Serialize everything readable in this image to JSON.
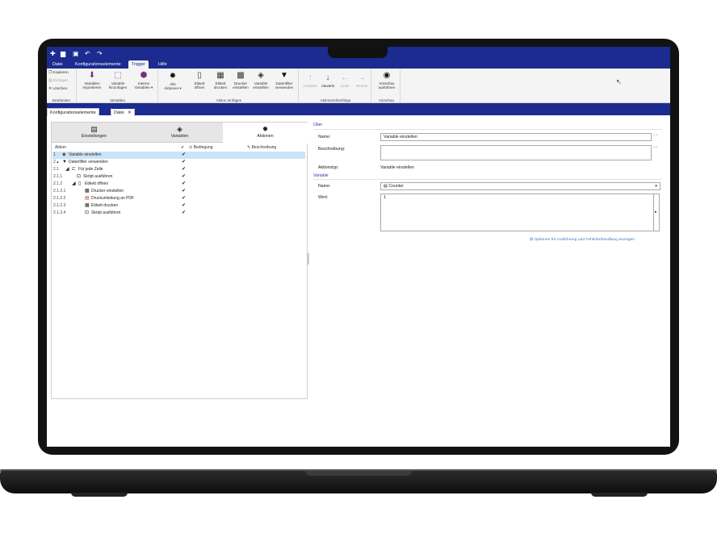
{
  "ribbon_tabs": [
    "Datei",
    "Konfigurationselemente",
    "Trigger",
    "Hilfe"
  ],
  "ribbon_active": "Trigger",
  "clipboard": {
    "copy": "Kopieren",
    "paste": "Einfügen",
    "delete": "Löschen",
    "label": "Bearbeiten"
  },
  "variables_group": {
    "label": "Variablen",
    "buttons": [
      "Variablen\nimportieren",
      "Variable\nhinzufügen",
      "Interne\nVariablen ▾"
    ]
  },
  "insert_group": {
    "label": "Aktion einfügen",
    "all_actions": "Alle\nAktionen ▾",
    "buttons": [
      "Etikett\nöffnen",
      "Etikett\ndrucken",
      "Drucker\neinstellen",
      "Variable\neinstellen",
      "Datenfilter\nverwenden"
    ]
  },
  "order_group": {
    "label": "Aktionsreihenfolge",
    "buttons": [
      "Aufwärts",
      "Abwärts",
      "Links",
      "Rechts"
    ]
  },
  "preview_group": {
    "label": "Vorschau",
    "button": "Vorschau\nausführen"
  },
  "doc_tabs": [
    "Konfigurationselemente",
    "Datei"
  ],
  "panel_tabs": [
    "Einstellungen",
    "Variablen",
    "Aktionen"
  ],
  "table_headers": {
    "action": "Aktion",
    "condition": "Bedingung",
    "description": "Beschreibung"
  },
  "actions": [
    {
      "num": "1",
      "label": "Variable einstellen",
      "checked": "✔"
    },
    {
      "num": "2 ▴",
      "label": "Datenfilter verwenden",
      "checked": "✔"
    },
    {
      "num": "2.1",
      "label": "Für jede Zeile",
      "checked": "✔"
    },
    {
      "num": "2.1.1",
      "label": "Skript ausführen",
      "checked": "✔"
    },
    {
      "num": "2.1.2",
      "label": "Etikett öffnen",
      "checked": "✔"
    },
    {
      "num": "2.1.2.1",
      "label": "Drucker einstellen",
      "checked": "✔"
    },
    {
      "num": "2.1.2.2",
      "label": "Druckumleitung an PDF",
      "checked": "✔"
    },
    {
      "num": "2.1.2.3",
      "label": "Etikett drucken",
      "checked": "✔"
    },
    {
      "num": "2.1.2.4",
      "label": "Skript ausführen",
      "checked": "✔"
    }
  ],
  "details": {
    "section_about": "Über",
    "name_label": "Name:",
    "name_value": "Variable einstellen",
    "description_label": "Beschreibung:",
    "action_type_label": "Aktionstyp:",
    "action_type_value": "Variable einstellen",
    "section_variable": "Variable",
    "var_name_label": "Name:",
    "var_name_value": "Counter",
    "value_label": "Wert:",
    "value_value": "1",
    "options_link": "Optionen für Ausführung und Fehlerbehandlung anzeigen"
  }
}
